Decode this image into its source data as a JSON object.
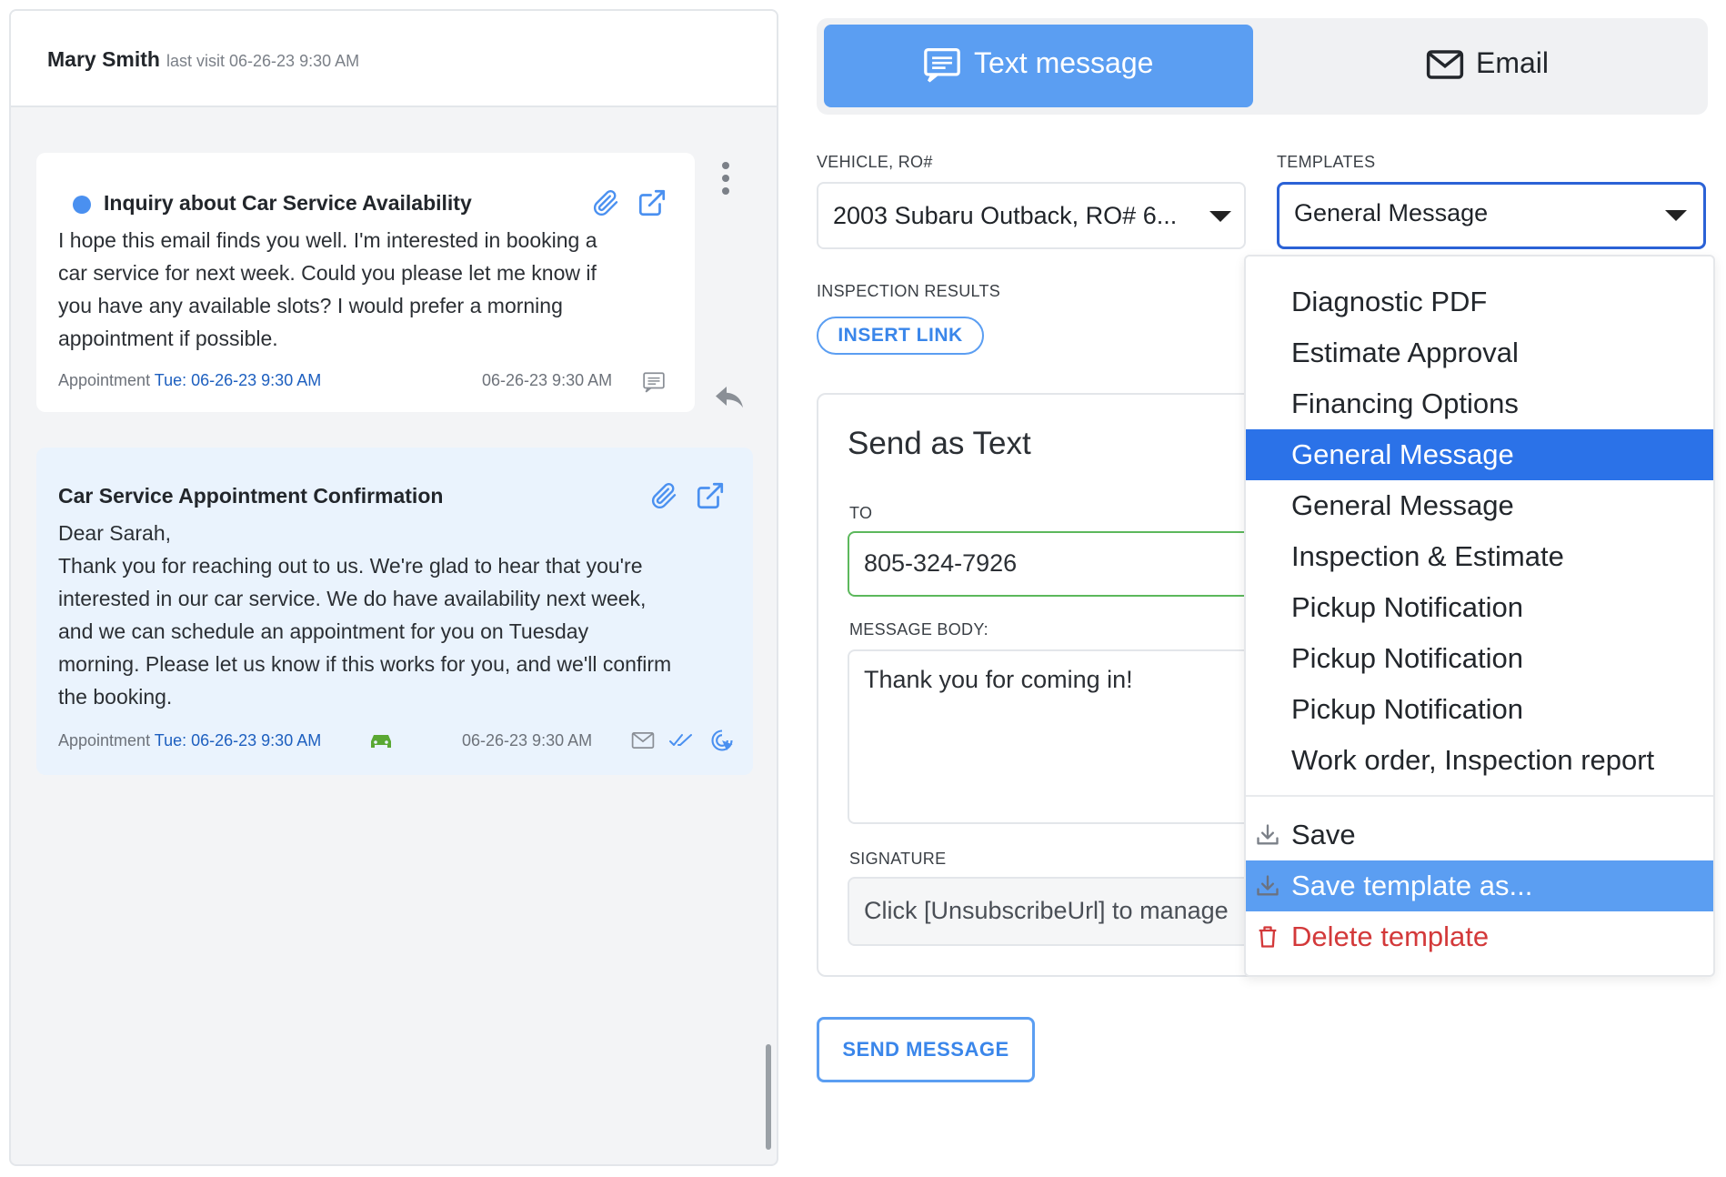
{
  "conversation": {
    "customer_name": "Mary Smith",
    "last_visit": "last visit 06-26-23 9:30 AM",
    "messages": [
      {
        "title": "Inquiry about Car Service Availability",
        "body": [
          "I hope this email finds you well. I'm interested in booking a",
          "car service for next week. Could you please let me know if",
          "you have any available slots? I would prefer a morning",
          "appointment if possible."
        ],
        "appointment_label": "Appointment",
        "appointment_value": "Tue: 06-26-23 9:30 AM",
        "timestamp": "06-26-23 9:30 AM"
      },
      {
        "title": "Car Service Appointment Confirmation",
        "body": [
          "Dear Sarah,",
          "Thank you for reaching out to us. We're glad to hear that you're",
          "interested in our car service. We do have availability next week,",
          "and we can schedule an appointment for you on Tuesday",
          "morning. Please let us know if this works for you, and we'll confirm",
          "the booking."
        ],
        "appointment_label": "Appointment",
        "appointment_value": "Tue: 06-26-23 9:30 AM",
        "timestamp": "06-26-23 9:30 AM"
      }
    ]
  },
  "tabs": {
    "text_label": "Text message",
    "email_label": "Email",
    "active": "text"
  },
  "form": {
    "vehicle_label": "VEHICLE, RO#",
    "vehicle_value": "2003 Subaru Outback, RO# 6...",
    "templates_label": "TEMPLATES",
    "templates_value": "General Message",
    "inspection_label": "INSPECTION RESULTS",
    "insert_link_label": "INSERT LINK",
    "send_as_title": "Send as Text",
    "to_label": "TO",
    "to_value": "805-324-7926",
    "body_label": "MESSAGE BODY:",
    "body_value": "Thank you for coming in!",
    "signature_label": "SIGNATURE",
    "signature_value": "Click [UnsubscribeUrl] to manage",
    "send_button_label": "SEND MESSAGE"
  },
  "template_menu": {
    "options": [
      "Diagnostic PDF",
      "Estimate Approval",
      "Financing Options",
      "General Message",
      "General Message",
      "Inspection & Estimate",
      "Pickup Notification",
      "Pickup Notification",
      "Pickup Notification",
      "Work order, Inspection report"
    ],
    "selected_index": 3,
    "save_label": "Save",
    "save_as_label": "Save template as...",
    "delete_label": "Delete template"
  },
  "colors": {
    "accent": "#5b9ef2",
    "selected": "#2b72e8",
    "danger": "#d3393a",
    "link": "#1d5fbf",
    "valid_border": "#5cb85c"
  }
}
